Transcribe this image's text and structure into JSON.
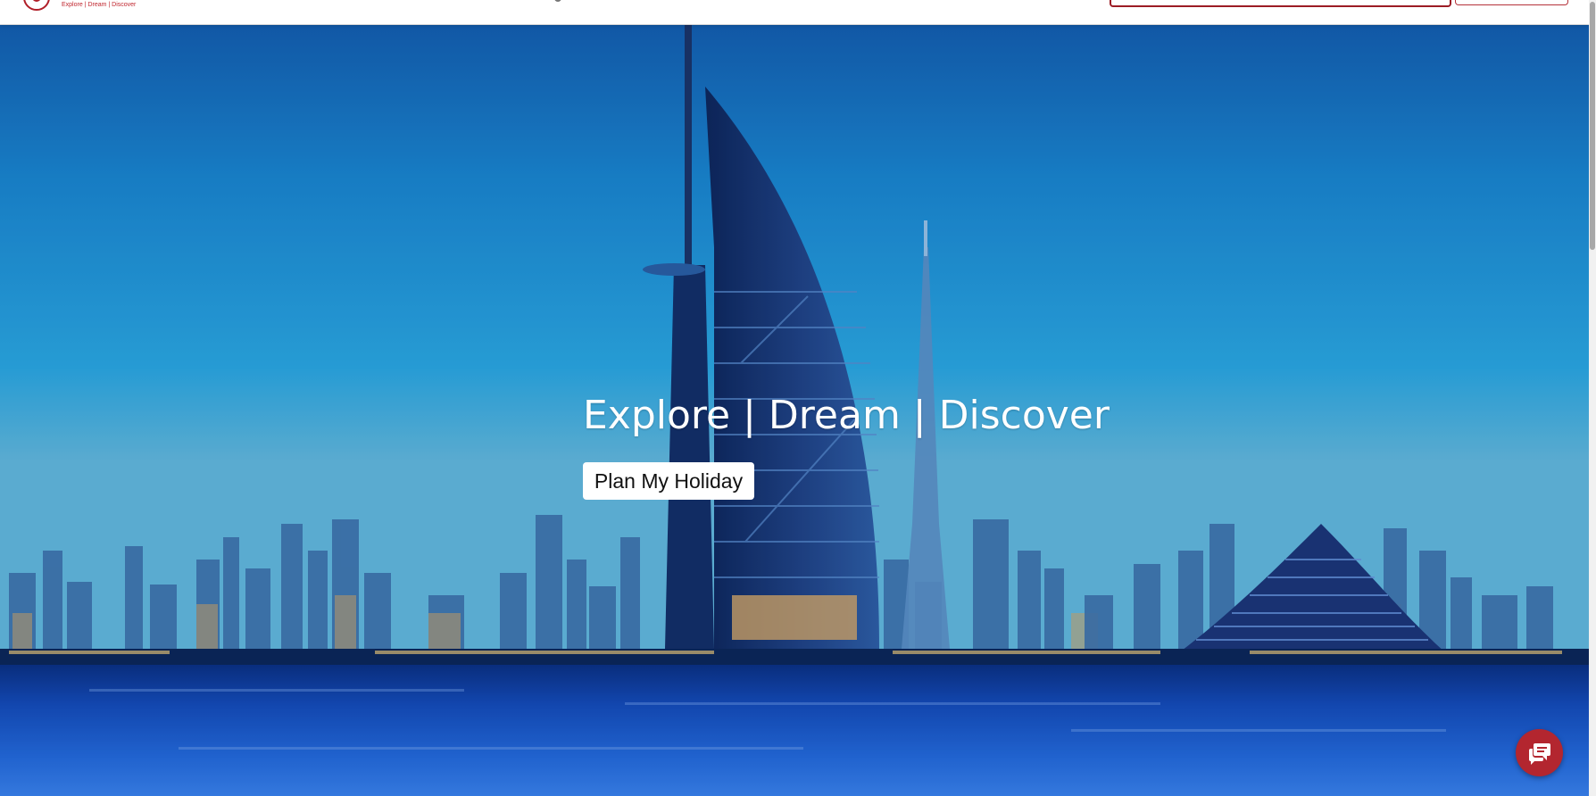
{
  "header": {
    "logo_tagline": "Explore | Dream | Discover"
  },
  "hero": {
    "title": "Explore | Dream | Discover",
    "cta_label": "Plan My Holiday"
  },
  "icons": {
    "logo": "logo-icon",
    "chat": "chat-icon"
  },
  "colors": {
    "brand_red": "#b3262f",
    "button_bg": "#ffffff",
    "hero_text": "#ffffff"
  }
}
